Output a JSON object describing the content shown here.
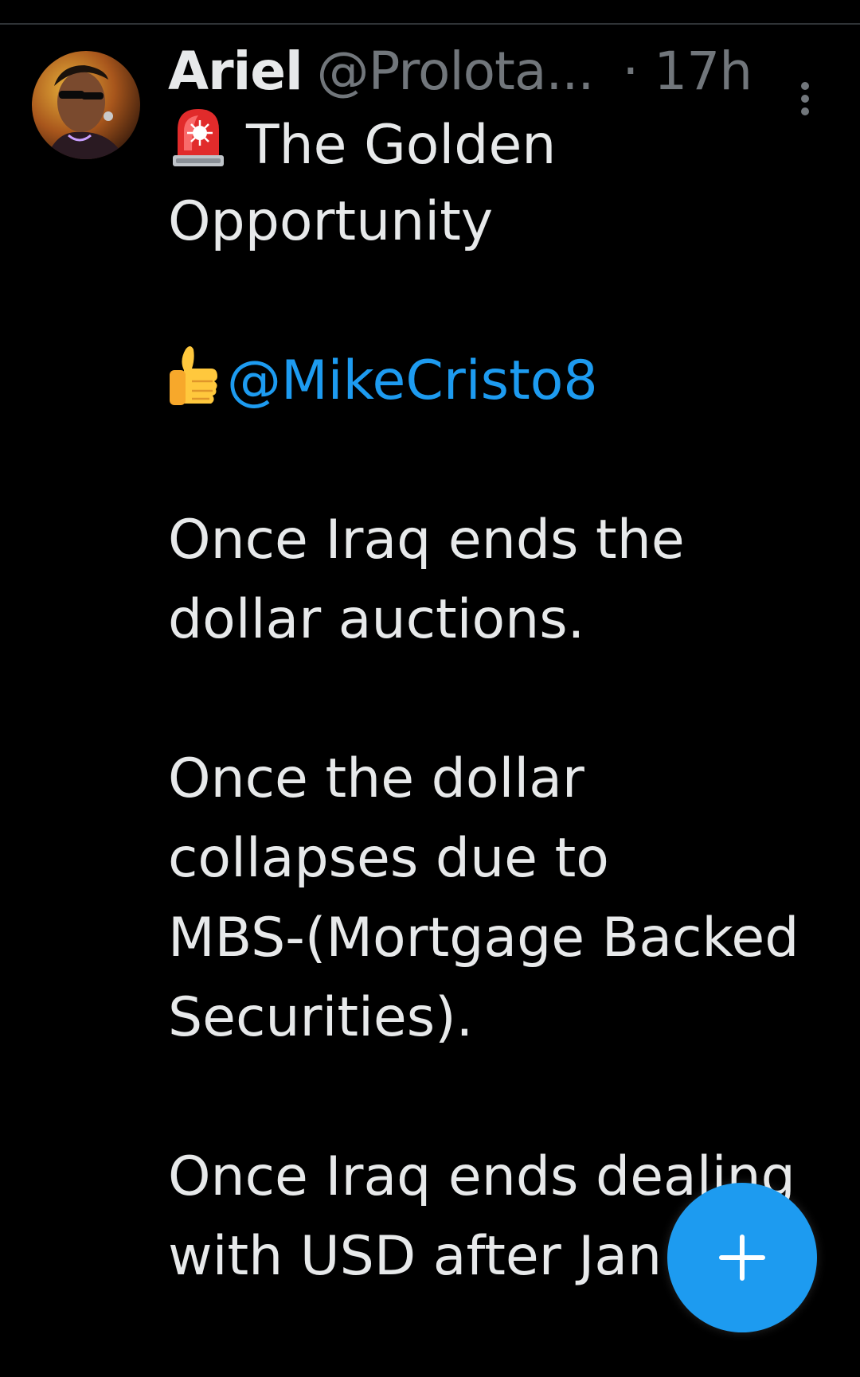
{
  "colors": {
    "background": "#000000",
    "text_primary": "#e7e9ea",
    "text_secondary": "#71767b",
    "accent": "#1d9bf0",
    "divider": "#2f3336"
  },
  "tweet": {
    "author": {
      "display_name": "Ariel",
      "handle": "@Prolota...",
      "avatar_icon": "avatar-image"
    },
    "timestamp": "· 17h",
    "more_icon": "more-vertical-icon",
    "body": {
      "title_line1": "The Golden",
      "title_line2": "Opportunity",
      "title_emoji": "police-siren-emoji",
      "mention_emoji": "thumbs-up-emoji",
      "mention": "@MikeCristo8",
      "p1_line1": "Once Iraq ends the",
      "p1_line2": "dollar auctions.",
      "p2_line1": "Once the dollar",
      "p2_line2": "collapses due to",
      "p2_line3": "MBS-(Mortgage Backed",
      "p2_line4": "Securities).",
      "p3_line1": "Once Iraq ends dealing",
      "p3_line2": "with USD after Jan"
    }
  },
  "fab": {
    "icon": "plus-icon"
  }
}
